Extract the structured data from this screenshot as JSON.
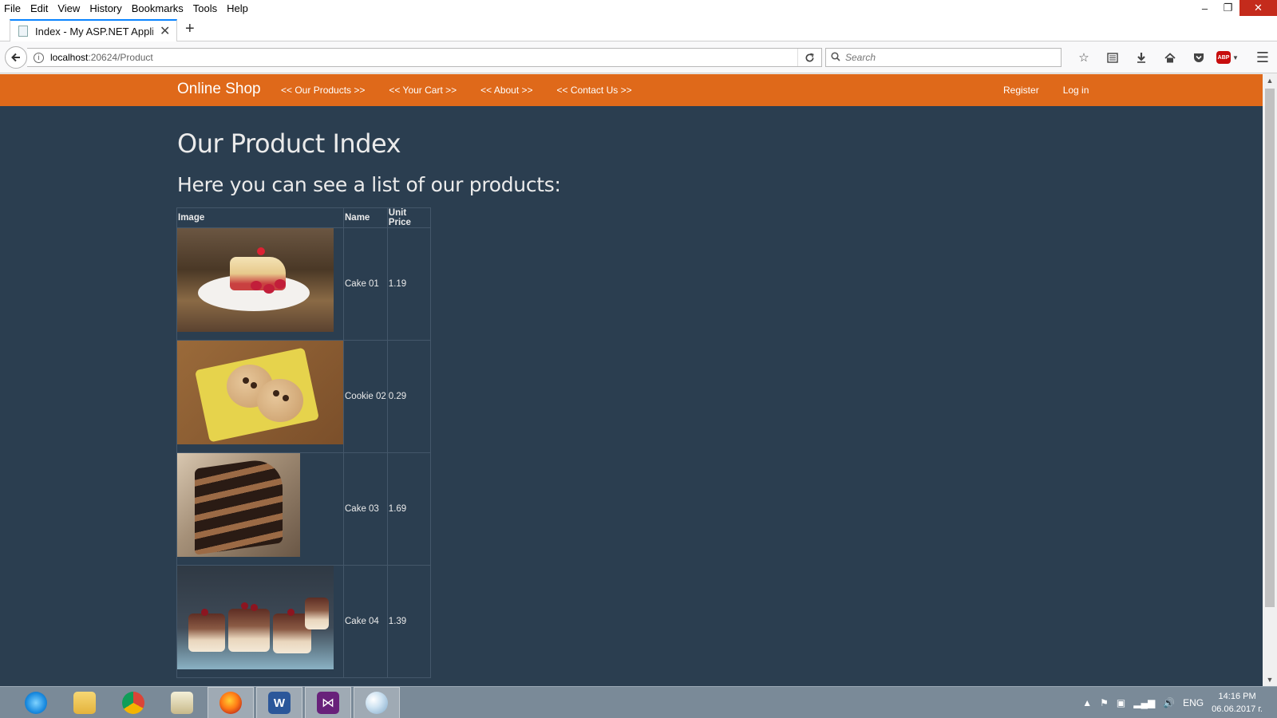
{
  "menu": [
    "File",
    "Edit",
    "View",
    "History",
    "Bookmarks",
    "Tools",
    "Help"
  ],
  "window_controls": {
    "minimize": "–",
    "restore": "❐",
    "close": "✕"
  },
  "tab": {
    "title": "Index - My ASP.NET Applica",
    "close": "✕",
    "new_tab": "+"
  },
  "nav": {
    "url_host": "localhost",
    "url_path": ":20624/Product",
    "search_placeholder": "Search"
  },
  "toolbar_icons": [
    "star-icon",
    "reading-list-icon",
    "download-icon",
    "home-icon",
    "pocket-icon",
    "adblock-icon",
    "menu-icon"
  ],
  "adblock_label": "ABP",
  "site": {
    "brand": "Online Shop",
    "links": [
      "<< Our Products >>",
      "<< Your Cart >>",
      "<< About >>",
      "<< Contact Us >>"
    ],
    "auth": [
      "Register",
      "Log in"
    ]
  },
  "page": {
    "title": "Our Product Index",
    "subtitle": "Here you can see a list of our products:"
  },
  "table": {
    "headers": [
      "Image",
      "Name",
      "Unit Price"
    ],
    "rows": [
      {
        "name": "Cake 01",
        "price": "1.19",
        "image": "cake-slice-photo"
      },
      {
        "name": "Cookie 02",
        "price": "0.29",
        "image": "cookies-photo"
      },
      {
        "name": "Cake 03",
        "price": "1.69",
        "image": "chocolate-cake-photo"
      },
      {
        "name": "Cake 04",
        "price": "1.39",
        "image": "mini-cakes-photo"
      }
    ]
  },
  "taskbar": {
    "apps": [
      "internet-explorer-icon",
      "file-explorer-icon",
      "chrome-icon",
      "notepad-icon",
      "firefox-icon",
      "word-icon",
      "visual-studio-icon",
      "paint-icon"
    ],
    "tray_lang": "ENG",
    "time": "14:16 PM",
    "date": "06.06.2017 г."
  },
  "colors": {
    "navbar": "#df691a",
    "page_bg": "#2b3e50",
    "text": "#ebebeb"
  }
}
